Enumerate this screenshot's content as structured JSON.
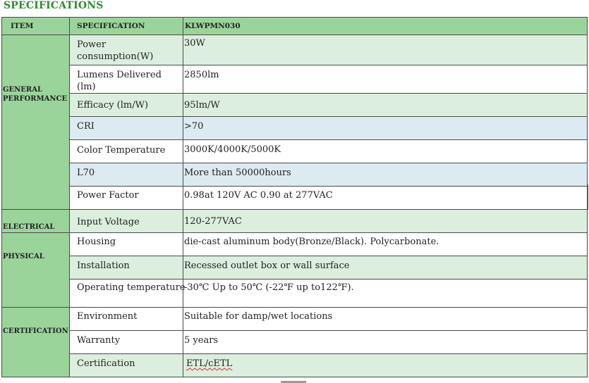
{
  "title": "SPECIFICATIONS",
  "header": {
    "item": "ITEM",
    "specification": "SPECIFICATION",
    "model": "KLWPMN030"
  },
  "categories": {
    "general": [
      "GENERAL",
      "PERFORMANCE"
    ],
    "electrical": "ELECTRICAL",
    "physical": "PHYSICAL",
    "certification": "CERTIFICATION"
  },
  "rows": [
    {
      "spec": "Power consumption(W)",
      "value": "30W"
    },
    {
      "spec": "Lumens Delivered (lm)",
      "value": "2850lm"
    },
    {
      "spec": "Efficacy (lm/W)",
      "value": "95lm/W"
    },
    {
      "spec": "CRI",
      "value": ">70"
    },
    {
      "spec": "Color Temperature",
      "value": "3000K/4000K/5000K"
    },
    {
      "spec": "L70",
      "value": "More than 50000hours"
    },
    {
      "spec": "Power Factor",
      "value": "0.98at 120V AC  0.90 at 277VAC"
    },
    {
      "spec": "Input Voltage",
      "value": "120-277VAC"
    },
    {
      "spec": "Housing",
      "value": "die-cast aluminum body(Bronze/Black). Polycarbonate."
    },
    {
      "spec": "Installation",
      "value": "Recessed outlet box  or  wall surface"
    },
    {
      "spec": "Operating temperature",
      "value": "-30℃ Up to 50℃ (-22℉ up to122℉)."
    },
    {
      "spec": "Environment",
      "value": "Suitable for damp/wet locations"
    },
    {
      "spec": "Warranty",
      "value": "5 years"
    },
    {
      "spec": "Certification",
      "value": "ETL/cETL"
    }
  ],
  "colors": {
    "title": "#2e8b2e",
    "header_bg": "#9bd49b",
    "green_row": "#dceedd",
    "blue_row": "#ddeaf1"
  }
}
